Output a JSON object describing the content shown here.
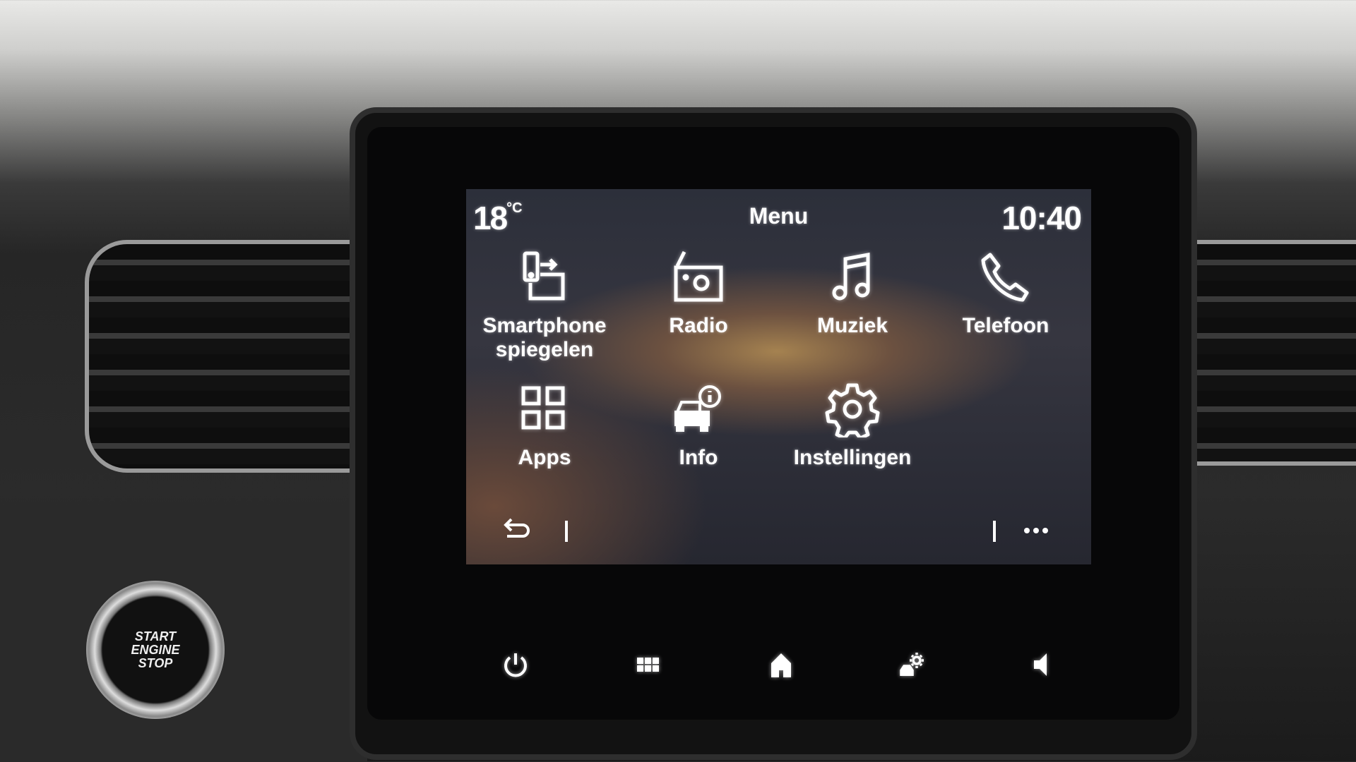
{
  "status": {
    "temperature": "18",
    "temperature_unit": "°C",
    "title": "Menu",
    "clock": "10:40"
  },
  "menu": {
    "items": [
      {
        "label": "Smartphone spiegelen",
        "icon": "smartphone-mirror-icon"
      },
      {
        "label": "Radio",
        "icon": "radio-icon"
      },
      {
        "label": "Muziek",
        "icon": "music-note-icon"
      },
      {
        "label": "Telefoon",
        "icon": "phone-icon"
      },
      {
        "label": "Apps",
        "icon": "apps-grid-icon"
      },
      {
        "label": "Info",
        "icon": "car-info-icon"
      },
      {
        "label": "Instellingen",
        "icon": "gear-icon"
      }
    ]
  },
  "bottom": {
    "back_icon": "back-arrow-icon",
    "more_icon": "more-dots-icon"
  },
  "hardware_buttons": [
    "power-icon",
    "grid-icon",
    "home-icon",
    "car-settings-icon",
    "volume-icon"
  ],
  "start_button": {
    "line1": "START",
    "line2": "ENGINE",
    "line3": "STOP"
  }
}
